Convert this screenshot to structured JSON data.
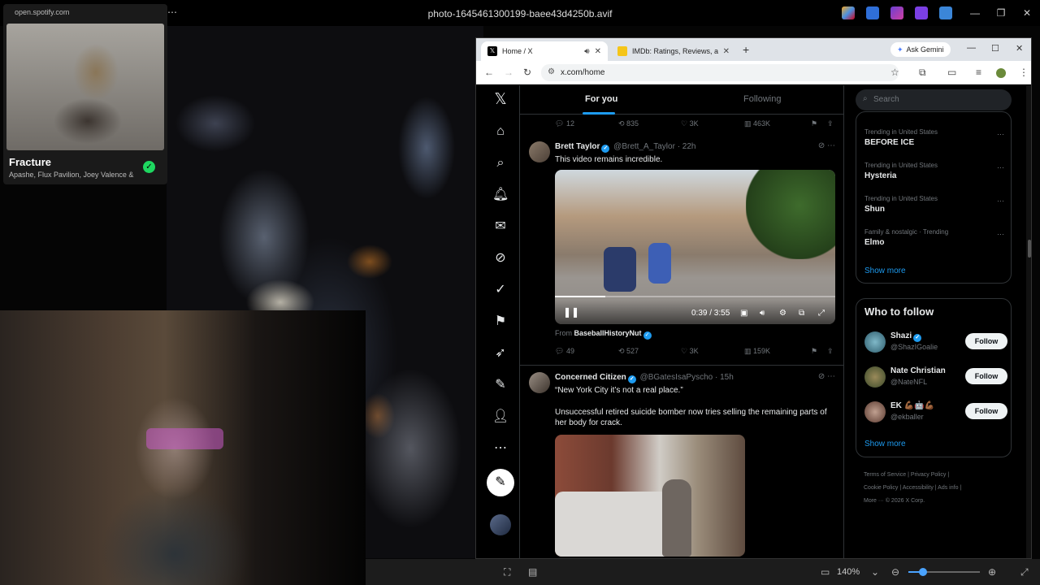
{
  "viewer": {
    "filename": "photo-1645461300199-baee43d4250b.avif",
    "zoom": "140%",
    "zoom_level": 0.2
  },
  "spotify": {
    "url": "open.spotify.com",
    "track": "Fracture",
    "artists": "Apashe, Flux Pavilion, Joey Valence & Brae"
  },
  "browser": {
    "tabs": [
      {
        "label": "Home / X"
      },
      {
        "label": "IMDb: Ratings, Reviews, and W"
      }
    ],
    "ask_gemini": "Ask Gemini",
    "url": "x.com/home"
  },
  "x": {
    "feed_tabs": {
      "for_you": "For you",
      "following": "Following"
    },
    "top_actions": {
      "replies": "12",
      "reposts": "835",
      "likes": "3K",
      "views": "463K"
    },
    "posts": [
      {
        "name": "Brett Taylor",
        "handle": "@Brett_A_Taylor",
        "time": "· 22h",
        "text": "This video remains incredible.",
        "video_time": "0:39 / 3:55",
        "video_progress": 0.18,
        "from_label": "From",
        "from_account": "BaseballHistoryNut",
        "actions": {
          "replies": "49",
          "reposts": "527",
          "likes": "3K",
          "views": "159K"
        }
      },
      {
        "name": "Concerned Citizen",
        "handle": "@BGatesIsaPyscho",
        "time": "· 15h",
        "text1": "“New York City it’s not a real place.”",
        "text2": "Unsuccessful retired suicide bomber now tries selling the remaining parts of her body for crack."
      }
    ],
    "search_placeholder": "Search",
    "trends": [
      {
        "context": "Trending in United States",
        "name": "BEFORE ICE"
      },
      {
        "context": "Trending in United States",
        "name": "Hysteria"
      },
      {
        "context": "Trending in United States",
        "name": "Shun"
      },
      {
        "context": "Family & nostalgic · Trending",
        "name": "Elmo"
      }
    ],
    "show_more": "Show more",
    "who_to_follow": {
      "title": "Who to follow",
      "accounts": [
        {
          "name": "Shazi",
          "handle": "@ShazIGoalie"
        },
        {
          "name": "Nate Christian",
          "handle": "@NateNFL"
        },
        {
          "name": "EK 💪🏾🤖💪🏾",
          "handle": "@ekballer"
        }
      ],
      "follow_label": "Follow",
      "show_more": "Show more"
    },
    "footer": {
      "line1": "Terms of Service  |  Privacy Policy  |",
      "line2": "Cookie Policy  |  Accessibility  |  Ads info  |",
      "line3": "More ···   © 2026 X Corp."
    }
  }
}
